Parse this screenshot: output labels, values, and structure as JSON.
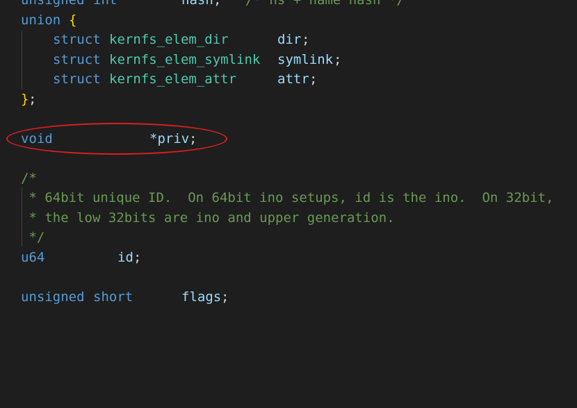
{
  "code": {
    "l0": {
      "type1": "unsigned",
      "type2": "int",
      "name": "hash",
      "semi": ";",
      "comment": "/* ns + name hash */"
    },
    "l1": {
      "kw": "union",
      "brace": "{"
    },
    "l2": {
      "kw": "struct",
      "type": "kernfs_elem_dir",
      "name": "dir",
      "semi": ";"
    },
    "l3": {
      "kw": "struct",
      "type": "kernfs_elem_symlink",
      "name": "symlink",
      "semi": ";"
    },
    "l4": {
      "kw": "struct",
      "type": "kernfs_elem_attr",
      "name": "attr",
      "semi": ";"
    },
    "l5": {
      "brace": "}",
      "semi": ";"
    },
    "l6": {
      "kw": "void",
      "name": "*priv",
      "semi": ";"
    },
    "l7": {
      "comment": "/*"
    },
    "l8": {
      "comment": " * 64bit unique ID.  On 64bit ino setups, id is the ino.  On 32bit,"
    },
    "l9": {
      "comment": " * the low 32bits are ino and upper generation."
    },
    "l10": {
      "comment": " */"
    },
    "l11": {
      "type": "u64",
      "name": "id",
      "semi": ";"
    },
    "l12": {
      "kw1": "unsigned",
      "kw2": "short",
      "name": "flags",
      "semi": ";"
    }
  },
  "colors": {
    "background": "#1e1e1e",
    "keyword": "#569cd6",
    "type": "#4ec9b0",
    "variable": "#9cdcfe",
    "brace": "#ffd700",
    "comment": "#6a9955",
    "highlight": "#e01e1e"
  }
}
